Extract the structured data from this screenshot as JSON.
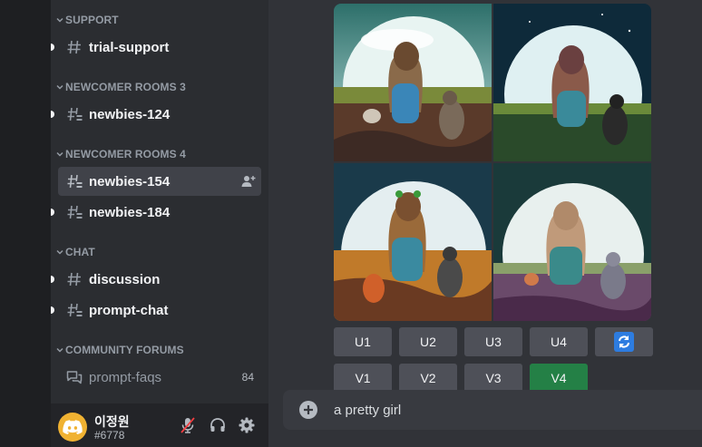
{
  "sidebar": {
    "categories": [
      {
        "label": "SUPPORT",
        "channels": [
          {
            "label": "trial-support",
            "icon": "hash-icon"
          }
        ]
      },
      {
        "label": "NEWCOMER ROOMS 3",
        "channels": [
          {
            "label": "newbies-124",
            "icon": "threaded-hash-icon"
          }
        ]
      },
      {
        "label": "NEWCOMER ROOMS 4",
        "channels": [
          {
            "label": "newbies-154",
            "icon": "threaded-hash-icon",
            "active": true
          },
          {
            "label": "newbies-184",
            "icon": "threaded-hash-icon"
          }
        ]
      },
      {
        "label": "CHAT",
        "channels": [
          {
            "label": "discussion",
            "icon": "hash-icon"
          },
          {
            "label": "prompt-chat",
            "icon": "threaded-hash-icon"
          }
        ]
      },
      {
        "label": "COMMUNITY FORUMS",
        "channels": [
          {
            "label": "prompt-faqs",
            "icon": "forum-icon",
            "count": "84"
          }
        ]
      }
    ]
  },
  "user": {
    "name": "이정원",
    "tag": "#6778"
  },
  "buttons": {
    "upscale": [
      "U1",
      "U2",
      "U3",
      "U4"
    ],
    "variation": [
      "V1",
      "V2",
      "V3",
      "V4"
    ],
    "selected": "V4"
  },
  "composer": {
    "text": "a pretty girl"
  },
  "colors": {
    "accent_green": "#248046",
    "button_gray": "#4e5058",
    "reroll_blue": "#2d7ce0"
  }
}
